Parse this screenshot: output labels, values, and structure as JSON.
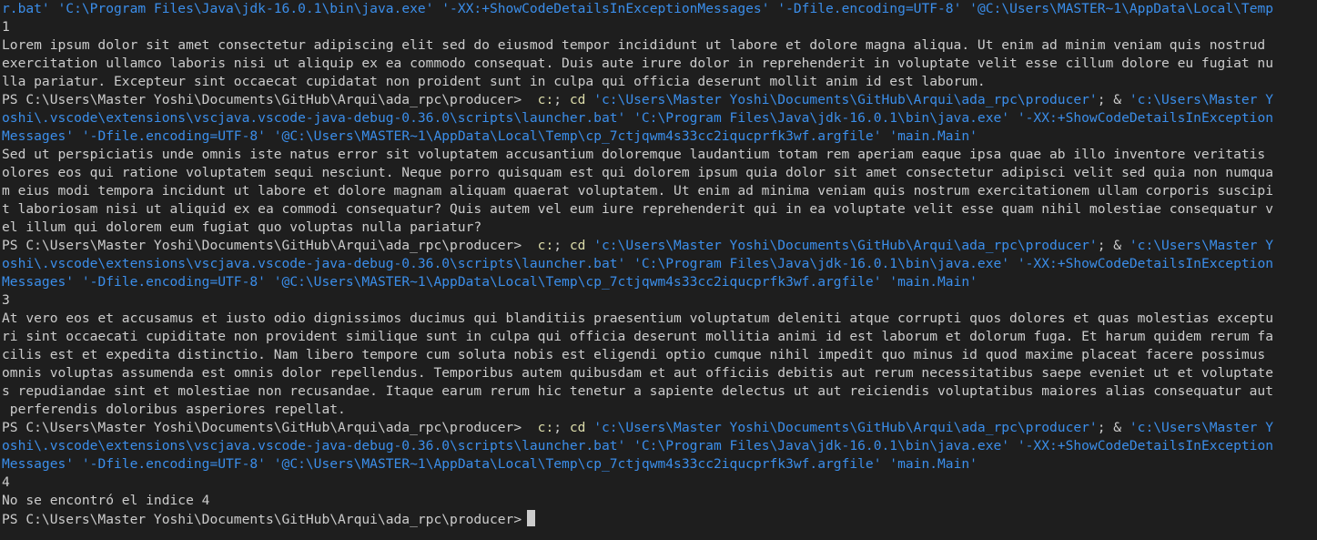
{
  "terminal": {
    "lines": [
      {
        "segments": [
          {
            "t": "r.bat' ",
            "c": "str"
          },
          {
            "t": "'C:\\Program Files\\Java\\jdk-16.0.1\\bin\\java.exe' ",
            "c": "str"
          },
          {
            "t": "'-XX:+ShowCodeDetailsInExceptionMessages' ",
            "c": "str"
          },
          {
            "t": "'-Dfile.encoding=UTF-8' ",
            "c": "str"
          },
          {
            "t": "'@C:\\Users\\MASTER~1\\AppData\\Local\\Temp",
            "c": "str"
          }
        ]
      },
      {
        "segments": [
          {
            "t": "1",
            "c": "plain"
          }
        ]
      },
      {
        "segments": [
          {
            "t": "Lorem ipsum dolor sit amet consectetur adipiscing elit sed do eiusmod tempor incididunt ut labore et dolore magna aliqua. Ut enim ad minim veniam quis nostrud",
            "c": "plain"
          }
        ]
      },
      {
        "segments": [
          {
            "t": "exercitation ullamco laboris nisi ut aliquip ex ea commodo consequat. Duis aute irure dolor in reprehenderit in voluptate velit esse cillum dolore eu fugiat nu",
            "c": "plain"
          }
        ]
      },
      {
        "segments": [
          {
            "t": "lla pariatur. Excepteur sint occaecat cupidatat non proident sunt in culpa qui officia deserunt mollit anim id est laborum.",
            "c": "plain"
          }
        ]
      },
      {
        "segments": [
          {
            "t": "PS C:\\Users\\Master Yoshi\\Documents\\GitHub\\Arqui\\ada_rpc\\producer> ",
            "c": "prompt"
          },
          {
            "t": " c:",
            "c": "cmd-yellow"
          },
          {
            "t": "; ",
            "c": "plain"
          },
          {
            "t": "cd ",
            "c": "cmd-yellow"
          },
          {
            "t": "'c:\\Users\\Master Yoshi\\Documents\\GitHub\\Arqui\\ada_rpc\\producer'",
            "c": "str"
          },
          {
            "t": "; & ",
            "c": "plain"
          },
          {
            "t": "'c:\\Users\\Master Y",
            "c": "str"
          }
        ]
      },
      {
        "segments": [
          {
            "t": "oshi\\.vscode\\extensions\\vscjava.vscode-java-debug-0.36.0\\scripts\\launcher.bat' ",
            "c": "str"
          },
          {
            "t": "'C:\\Program Files\\Java\\jdk-16.0.1\\bin\\java.exe' ",
            "c": "str"
          },
          {
            "t": "'-XX:+ShowCodeDetailsInException",
            "c": "str"
          }
        ]
      },
      {
        "segments": [
          {
            "t": "Messages' ",
            "c": "str"
          },
          {
            "t": "'-Dfile.encoding=UTF-8' ",
            "c": "str"
          },
          {
            "t": "'@C:\\Users\\MASTER~1\\AppData\\Local\\Temp\\cp_7ctjqwm4s33cc2iqucprfk3wf.argfile' ",
            "c": "str"
          },
          {
            "t": "'main.Main'",
            "c": "str"
          }
        ]
      },
      {
        "segments": [
          {
            "t": "Sed ut perspiciatis unde omnis iste natus error sit voluptatem accusantium doloremque laudantium totam rem aperiam eaque ipsa quae ab illo inventore veritatis",
            "c": "plain"
          }
        ]
      },
      {
        "segments": [
          {
            "t": "olores eos qui ratione voluptatem sequi nesciunt. Neque porro quisquam est qui dolorem ipsum quia dolor sit amet consectetur adipisci velit sed quia non numqua",
            "c": "plain"
          }
        ]
      },
      {
        "segments": [
          {
            "t": "m eius modi tempora incidunt ut labore et dolore magnam aliquam quaerat voluptatem. Ut enim ad minima veniam quis nostrum exercitationem ullam corporis suscipi",
            "c": "plain"
          }
        ]
      },
      {
        "segments": [
          {
            "t": "t laboriosam nisi ut aliquid ex ea commodi consequatur? Quis autem vel eum iure reprehenderit qui in ea voluptate velit esse quam nihil molestiae consequatur v",
            "c": "plain"
          }
        ]
      },
      {
        "segments": [
          {
            "t": "el illum qui dolorem eum fugiat quo voluptas nulla pariatur?",
            "c": "plain"
          }
        ]
      },
      {
        "segments": [
          {
            "t": "PS C:\\Users\\Master Yoshi\\Documents\\GitHub\\Arqui\\ada_rpc\\producer> ",
            "c": "prompt"
          },
          {
            "t": " c:",
            "c": "cmd-yellow"
          },
          {
            "t": "; ",
            "c": "plain"
          },
          {
            "t": "cd ",
            "c": "cmd-yellow"
          },
          {
            "t": "'c:\\Users\\Master Yoshi\\Documents\\GitHub\\Arqui\\ada_rpc\\producer'",
            "c": "str"
          },
          {
            "t": "; & ",
            "c": "plain"
          },
          {
            "t": "'c:\\Users\\Master Y",
            "c": "str"
          }
        ]
      },
      {
        "segments": [
          {
            "t": "oshi\\.vscode\\extensions\\vscjava.vscode-java-debug-0.36.0\\scripts\\launcher.bat' ",
            "c": "str"
          },
          {
            "t": "'C:\\Program Files\\Java\\jdk-16.0.1\\bin\\java.exe' ",
            "c": "str"
          },
          {
            "t": "'-XX:+ShowCodeDetailsInException",
            "c": "str"
          }
        ]
      },
      {
        "segments": [
          {
            "t": "Messages' ",
            "c": "str"
          },
          {
            "t": "'-Dfile.encoding=UTF-8' ",
            "c": "str"
          },
          {
            "t": "'@C:\\Users\\MASTER~1\\AppData\\Local\\Temp\\cp_7ctjqwm4s33cc2iqucprfk3wf.argfile' ",
            "c": "str"
          },
          {
            "t": "'main.Main'",
            "c": "str"
          }
        ]
      },
      {
        "segments": [
          {
            "t": "3",
            "c": "plain"
          }
        ]
      },
      {
        "segments": [
          {
            "t": "At vero eos et accusamus et iusto odio dignissimos ducimus qui blanditiis praesentium voluptatum deleniti atque corrupti quos dolores et quas molestias exceptu",
            "c": "plain"
          }
        ]
      },
      {
        "segments": [
          {
            "t": "ri sint occaecati cupiditate non provident similique sunt in culpa qui officia deserunt mollitia animi id est laborum et dolorum fuga. Et harum quidem rerum fa",
            "c": "plain"
          }
        ]
      },
      {
        "segments": [
          {
            "t": "cilis est et expedita distinctio. Nam libero tempore cum soluta nobis est eligendi optio cumque nihil impedit quo minus id quod maxime placeat facere possimus",
            "c": "plain"
          }
        ]
      },
      {
        "segments": [
          {
            "t": "omnis voluptas assumenda est omnis dolor repellendus. Temporibus autem quibusdam et aut officiis debitis aut rerum necessitatibus saepe eveniet ut et voluptate",
            "c": "plain"
          }
        ]
      },
      {
        "segments": [
          {
            "t": "s repudiandae sint et molestiae non recusandae. Itaque earum rerum hic tenetur a sapiente delectus ut aut reiciendis voluptatibus maiores alias consequatur aut",
            "c": "plain"
          }
        ]
      },
      {
        "segments": [
          {
            "t": " perferendis doloribus asperiores repellat.",
            "c": "plain"
          }
        ]
      },
      {
        "segments": [
          {
            "t": "PS C:\\Users\\Master Yoshi\\Documents\\GitHub\\Arqui\\ada_rpc\\producer> ",
            "c": "prompt"
          },
          {
            "t": " c:",
            "c": "cmd-yellow"
          },
          {
            "t": "; ",
            "c": "plain"
          },
          {
            "t": "cd ",
            "c": "cmd-yellow"
          },
          {
            "t": "'c:\\Users\\Master Yoshi\\Documents\\GitHub\\Arqui\\ada_rpc\\producer'",
            "c": "str"
          },
          {
            "t": "; & ",
            "c": "plain"
          },
          {
            "t": "'c:\\Users\\Master Y",
            "c": "str"
          }
        ]
      },
      {
        "segments": [
          {
            "t": "oshi\\.vscode\\extensions\\vscjava.vscode-java-debug-0.36.0\\scripts\\launcher.bat' ",
            "c": "str"
          },
          {
            "t": "'C:\\Program Files\\Java\\jdk-16.0.1\\bin\\java.exe' ",
            "c": "str"
          },
          {
            "t": "'-XX:+ShowCodeDetailsInException",
            "c": "str"
          }
        ]
      },
      {
        "segments": [
          {
            "t": "Messages' ",
            "c": "str"
          },
          {
            "t": "'-Dfile.encoding=UTF-8' ",
            "c": "str"
          },
          {
            "t": "'@C:\\Users\\MASTER~1\\AppData\\Local\\Temp\\cp_7ctjqwm4s33cc2iqucprfk3wf.argfile' ",
            "c": "str"
          },
          {
            "t": "'main.Main'",
            "c": "str"
          }
        ]
      },
      {
        "segments": [
          {
            "t": "4",
            "c": "plain"
          }
        ]
      },
      {
        "segments": [
          {
            "t": "No se encontró el indice 4",
            "c": "plain"
          }
        ]
      },
      {
        "segments": [
          {
            "t": "PS C:\\Users\\Master Yoshi\\Documents\\GitHub\\Arqui\\ada_rpc\\producer>",
            "c": "prompt"
          }
        ],
        "cursor": true
      }
    ]
  },
  "colors": {
    "background": "#1e1e1e",
    "text": "#cccccc",
    "string": "#3b8eea",
    "command": "#dcdcaa"
  }
}
